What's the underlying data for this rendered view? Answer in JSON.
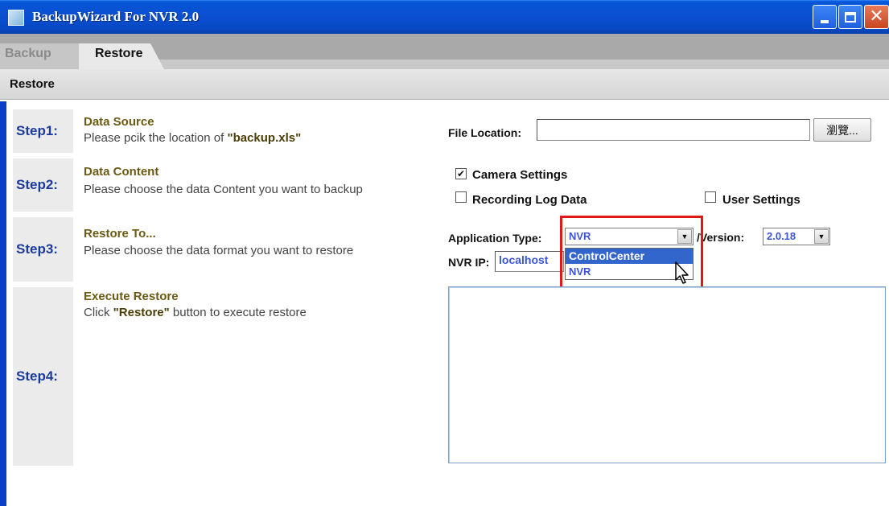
{
  "window": {
    "title": "BackupWizard For NVR 2.0",
    "controls": {
      "minimize": "minimize",
      "maximize": "maximize",
      "close": "close"
    }
  },
  "tabs": [
    {
      "label": "Backup",
      "active": false
    },
    {
      "label": "Restore",
      "active": true
    }
  ],
  "toolbar": {
    "label": "Restore"
  },
  "steps": [
    {
      "step": "Step1:",
      "title": "Data Source",
      "desc_prefix": "Please pcik the location of ",
      "desc_bold": "\"backup.xls\"",
      "desc_suffix": ""
    },
    {
      "step": "Step2:",
      "title": "Data Content",
      "desc_prefix": "Please choose the data Content you want to backup",
      "desc_bold": "",
      "desc_suffix": ""
    },
    {
      "step": "Step3:",
      "title": "Restore To...",
      "desc_prefix": "Please choose the data format you want to restore",
      "desc_bold": "",
      "desc_suffix": ""
    },
    {
      "step": "Step4:",
      "title": "Execute Restore",
      "desc_prefix": "Click ",
      "desc_bold": "\"Restore\"",
      "desc_suffix": " button to execute restore"
    }
  ],
  "file_location": {
    "label": "File Location:",
    "value": "",
    "browse_label": "瀏覽..."
  },
  "content_options": {
    "camera_settings": {
      "label": "Camera Settings",
      "checked": true,
      "mark": "✔"
    },
    "recording_log": {
      "label": "Recording Log Data",
      "checked": false,
      "mark": ""
    },
    "user_settings": {
      "label": "User Settings",
      "checked": false,
      "mark": ""
    }
  },
  "restore_to": {
    "app_type_label": "Application Type:",
    "app_type_value": "NVR",
    "app_type_options": [
      "ControlCenter",
      "NVR"
    ],
    "highlighted_option": "ControlCenter",
    "version_label": "/Version:",
    "version_value": "2.0.18",
    "nvr_ip_label": "NVR IP:",
    "nvr_ip_value": "localhost"
  },
  "log_output": "",
  "colors": {
    "title_bar": "#0a4fd0",
    "step_label": "#1b3b9c",
    "step_title": "#6b5a14",
    "highlight": "#e01818",
    "selection": "#3366cc"
  }
}
